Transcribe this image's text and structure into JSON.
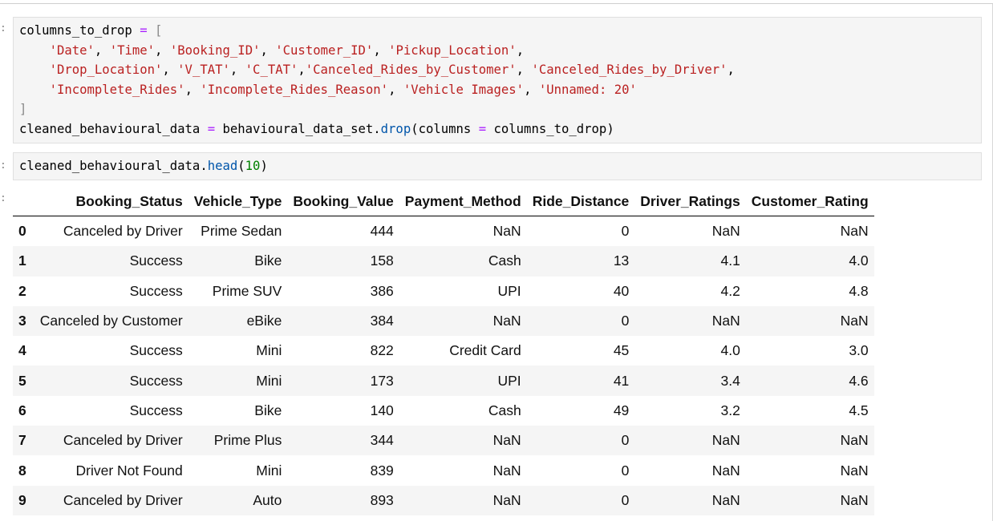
{
  "prompts": [
    ":",
    ":",
    ":"
  ],
  "code_cell_1": {
    "line1_var": "columns_to_drop",
    "line1_eq": " = ",
    "line1_open": "[",
    "line2_strings": [
      "'Date'",
      "'Time'",
      "'Booking_ID'",
      "'Customer_ID'",
      "'Pickup_Location'"
    ],
    "line3_strings": [
      "'Drop_Location'",
      "'V_TAT'",
      "'C_TAT'",
      "'Canceled_Rides_by_Customer'",
      "'Canceled_Rides_by_Driver'"
    ],
    "line4_strings": [
      "'Incomplete_Rides'",
      "'Incomplete_Rides_Reason'",
      "'Vehicle Images'",
      "'Unnamed: 20'"
    ],
    "line5_close": "]",
    "line6_lhs": "cleaned_behavioural_data",
    "line6_eq": " = ",
    "line6_obj": "behavioural_data_set.",
    "line6_func": "drop",
    "line6_args_open": "(columns ",
    "line6_args_eq": "=",
    "line6_args_rest": " columns_to_drop)"
  },
  "code_cell_2": {
    "obj": "cleaned_behavioural_data.",
    "func": "head",
    "open": "(",
    "arg": "10",
    "close": ")"
  },
  "table": {
    "columns": [
      "Booking_Status",
      "Vehicle_Type",
      "Booking_Value",
      "Payment_Method",
      "Ride_Distance",
      "Driver_Ratings",
      "Customer_Rating"
    ],
    "rows": [
      {
        "index": "0",
        "cells": [
          "Canceled by Driver",
          "Prime Sedan",
          "444",
          "NaN",
          "0",
          "NaN",
          "NaN"
        ]
      },
      {
        "index": "1",
        "cells": [
          "Success",
          "Bike",
          "158",
          "Cash",
          "13",
          "4.1",
          "4.0"
        ]
      },
      {
        "index": "2",
        "cells": [
          "Success",
          "Prime SUV",
          "386",
          "UPI",
          "40",
          "4.2",
          "4.8"
        ]
      },
      {
        "index": "3",
        "cells": [
          "Canceled by Customer",
          "eBike",
          "384",
          "NaN",
          "0",
          "NaN",
          "NaN"
        ]
      },
      {
        "index": "4",
        "cells": [
          "Success",
          "Mini",
          "822",
          "Credit Card",
          "45",
          "4.0",
          "3.0"
        ]
      },
      {
        "index": "5",
        "cells": [
          "Success",
          "Mini",
          "173",
          "UPI",
          "41",
          "3.4",
          "4.6"
        ]
      },
      {
        "index": "6",
        "cells": [
          "Success",
          "Bike",
          "140",
          "Cash",
          "49",
          "3.2",
          "4.5"
        ]
      },
      {
        "index": "7",
        "cells": [
          "Canceled by Driver",
          "Prime Plus",
          "344",
          "NaN",
          "0",
          "NaN",
          "NaN"
        ]
      },
      {
        "index": "8",
        "cells": [
          "Driver Not Found",
          "Mini",
          "839",
          "NaN",
          "0",
          "NaN",
          "NaN"
        ]
      },
      {
        "index": "9",
        "cells": [
          "Canceled by Driver",
          "Auto",
          "893",
          "NaN",
          "0",
          "NaN",
          "NaN"
        ]
      }
    ]
  },
  "colors": {
    "string": "#ba2121",
    "operator": "#aa22ff",
    "number": "#008000",
    "function": "#0055aa",
    "cell_bg": "#f5f5f5"
  }
}
